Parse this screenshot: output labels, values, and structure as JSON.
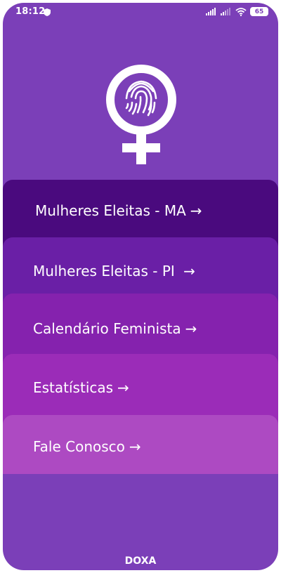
{
  "status_bar": {
    "time": "18:12",
    "battery": "65"
  },
  "logo": {
    "icon": "female-symbol-fingerprint-icon"
  },
  "menu": {
    "items": [
      {
        "label": "Mulheres Eleitas - MA",
        "arrow": "→"
      },
      {
        "label": "Mulheres Eleitas - PI ",
        "arrow": "→"
      },
      {
        "label": "Calendário Feminista",
        "arrow": "→"
      },
      {
        "label": "Estatísticas",
        "arrow": "→"
      },
      {
        "label": "Fale Conosco",
        "arrow": "→"
      }
    ]
  },
  "footer": {
    "text": "DOXA"
  },
  "colors": {
    "background": "#7b3fb8",
    "item1": "#4a0a7e",
    "item2": "#6a1fa6",
    "item3": "#8522ae",
    "item4": "#9b2cb8",
    "item5": "#ad4ac2"
  }
}
